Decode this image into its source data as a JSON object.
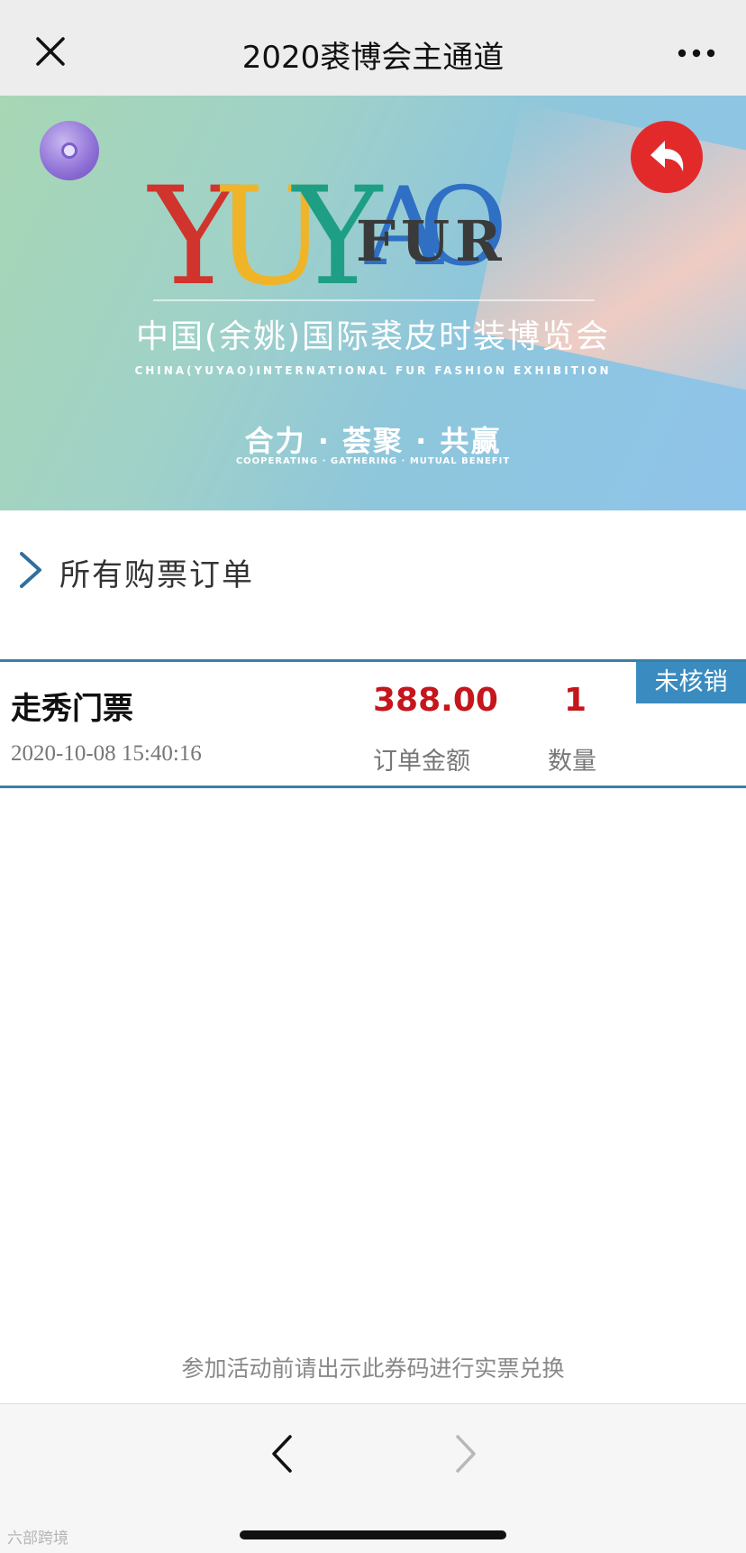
{
  "topbar": {
    "title": "2020裘博会主通道",
    "close_icon": "close-icon",
    "more_icon": "more-icon"
  },
  "banner": {
    "logo_letters": [
      "Y",
      "U",
      "Y",
      "A",
      "O"
    ],
    "logo_word": "FUR",
    "cn_title": "中国(余姚)国际裘皮时装博览会",
    "en_title": "CHINA(YUYAO)INTERNATIONAL FUR FASHION EXHIBITION",
    "slogan": "合力 · 荟聚 · 共赢",
    "slogan_en": "COOPERATING · GATHERING · MUTUAL BENEFIT",
    "colors": {
      "Y1": "#d0342c",
      "U": "#f0b429",
      "Y2": "#1e9e84",
      "A": "#2f6fc4",
      "O": "#2f6fc4",
      "back_button": "#e32a2a"
    }
  },
  "orders_link": {
    "label": "所有购票订单",
    "icon": "chevron-right-icon"
  },
  "order": {
    "name": "走秀门票",
    "time": "2020-10-08 15:40:16",
    "amount": "388.00",
    "amount_label": "订单金额",
    "quantity": "1",
    "quantity_label": "数量",
    "status": "未核销"
  },
  "hint": "参加活动前请出示此券码进行实票兑换",
  "bottombar": {
    "watermark": "六部跨境"
  }
}
